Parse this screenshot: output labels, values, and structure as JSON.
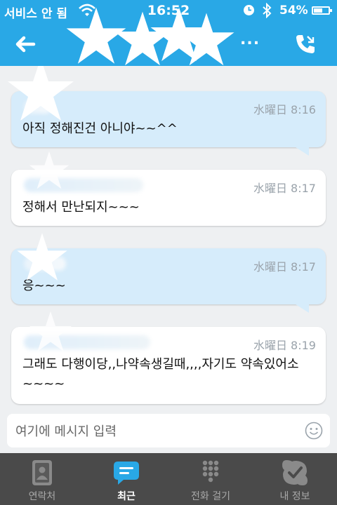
{
  "status_bar": {
    "carrier": "서비스 안 됨",
    "time": "16:52",
    "battery_percent": "54%",
    "battery_level": 0.54
  },
  "header": {
    "back_icon": "back-arrow-icon",
    "more_label": "...",
    "call_icon": "phone-call-icon"
  },
  "messages": [
    {
      "direction": "outgoing",
      "timestamp": "水曜日 8:16",
      "text": "아직 정해진건 아니야~~^^"
    },
    {
      "direction": "incoming",
      "timestamp": "水曜日 8:17",
      "text": "정해서 만난되지~~~"
    },
    {
      "direction": "outgoing",
      "timestamp": "水曜日 8:17",
      "text": "응~~~"
    },
    {
      "direction": "incoming",
      "timestamp": "水曜日 8:19",
      "text": "그래도 다행이당,,나약속생길때,,,,자기도 약속있어소~~~~"
    }
  ],
  "composer": {
    "placeholder": "여기에 메시지 입력",
    "emoji_icon": "smiley-icon"
  },
  "tabs": [
    {
      "label": "연락처",
      "icon": "contacts-book-icon",
      "active": false
    },
    {
      "label": "최근",
      "icon": "chat-bubble-icon",
      "active": true
    },
    {
      "label": "전화 걸기",
      "icon": "dialpad-icon",
      "active": false
    },
    {
      "label": "내 정보",
      "icon": "skype-check-icon",
      "active": false
    }
  ],
  "colors": {
    "brand_blue": "#29a8e6",
    "outgoing_bubble": "#d6ecfb",
    "incoming_bubble": "#ffffff",
    "tabbar": "#4a4a4a"
  }
}
